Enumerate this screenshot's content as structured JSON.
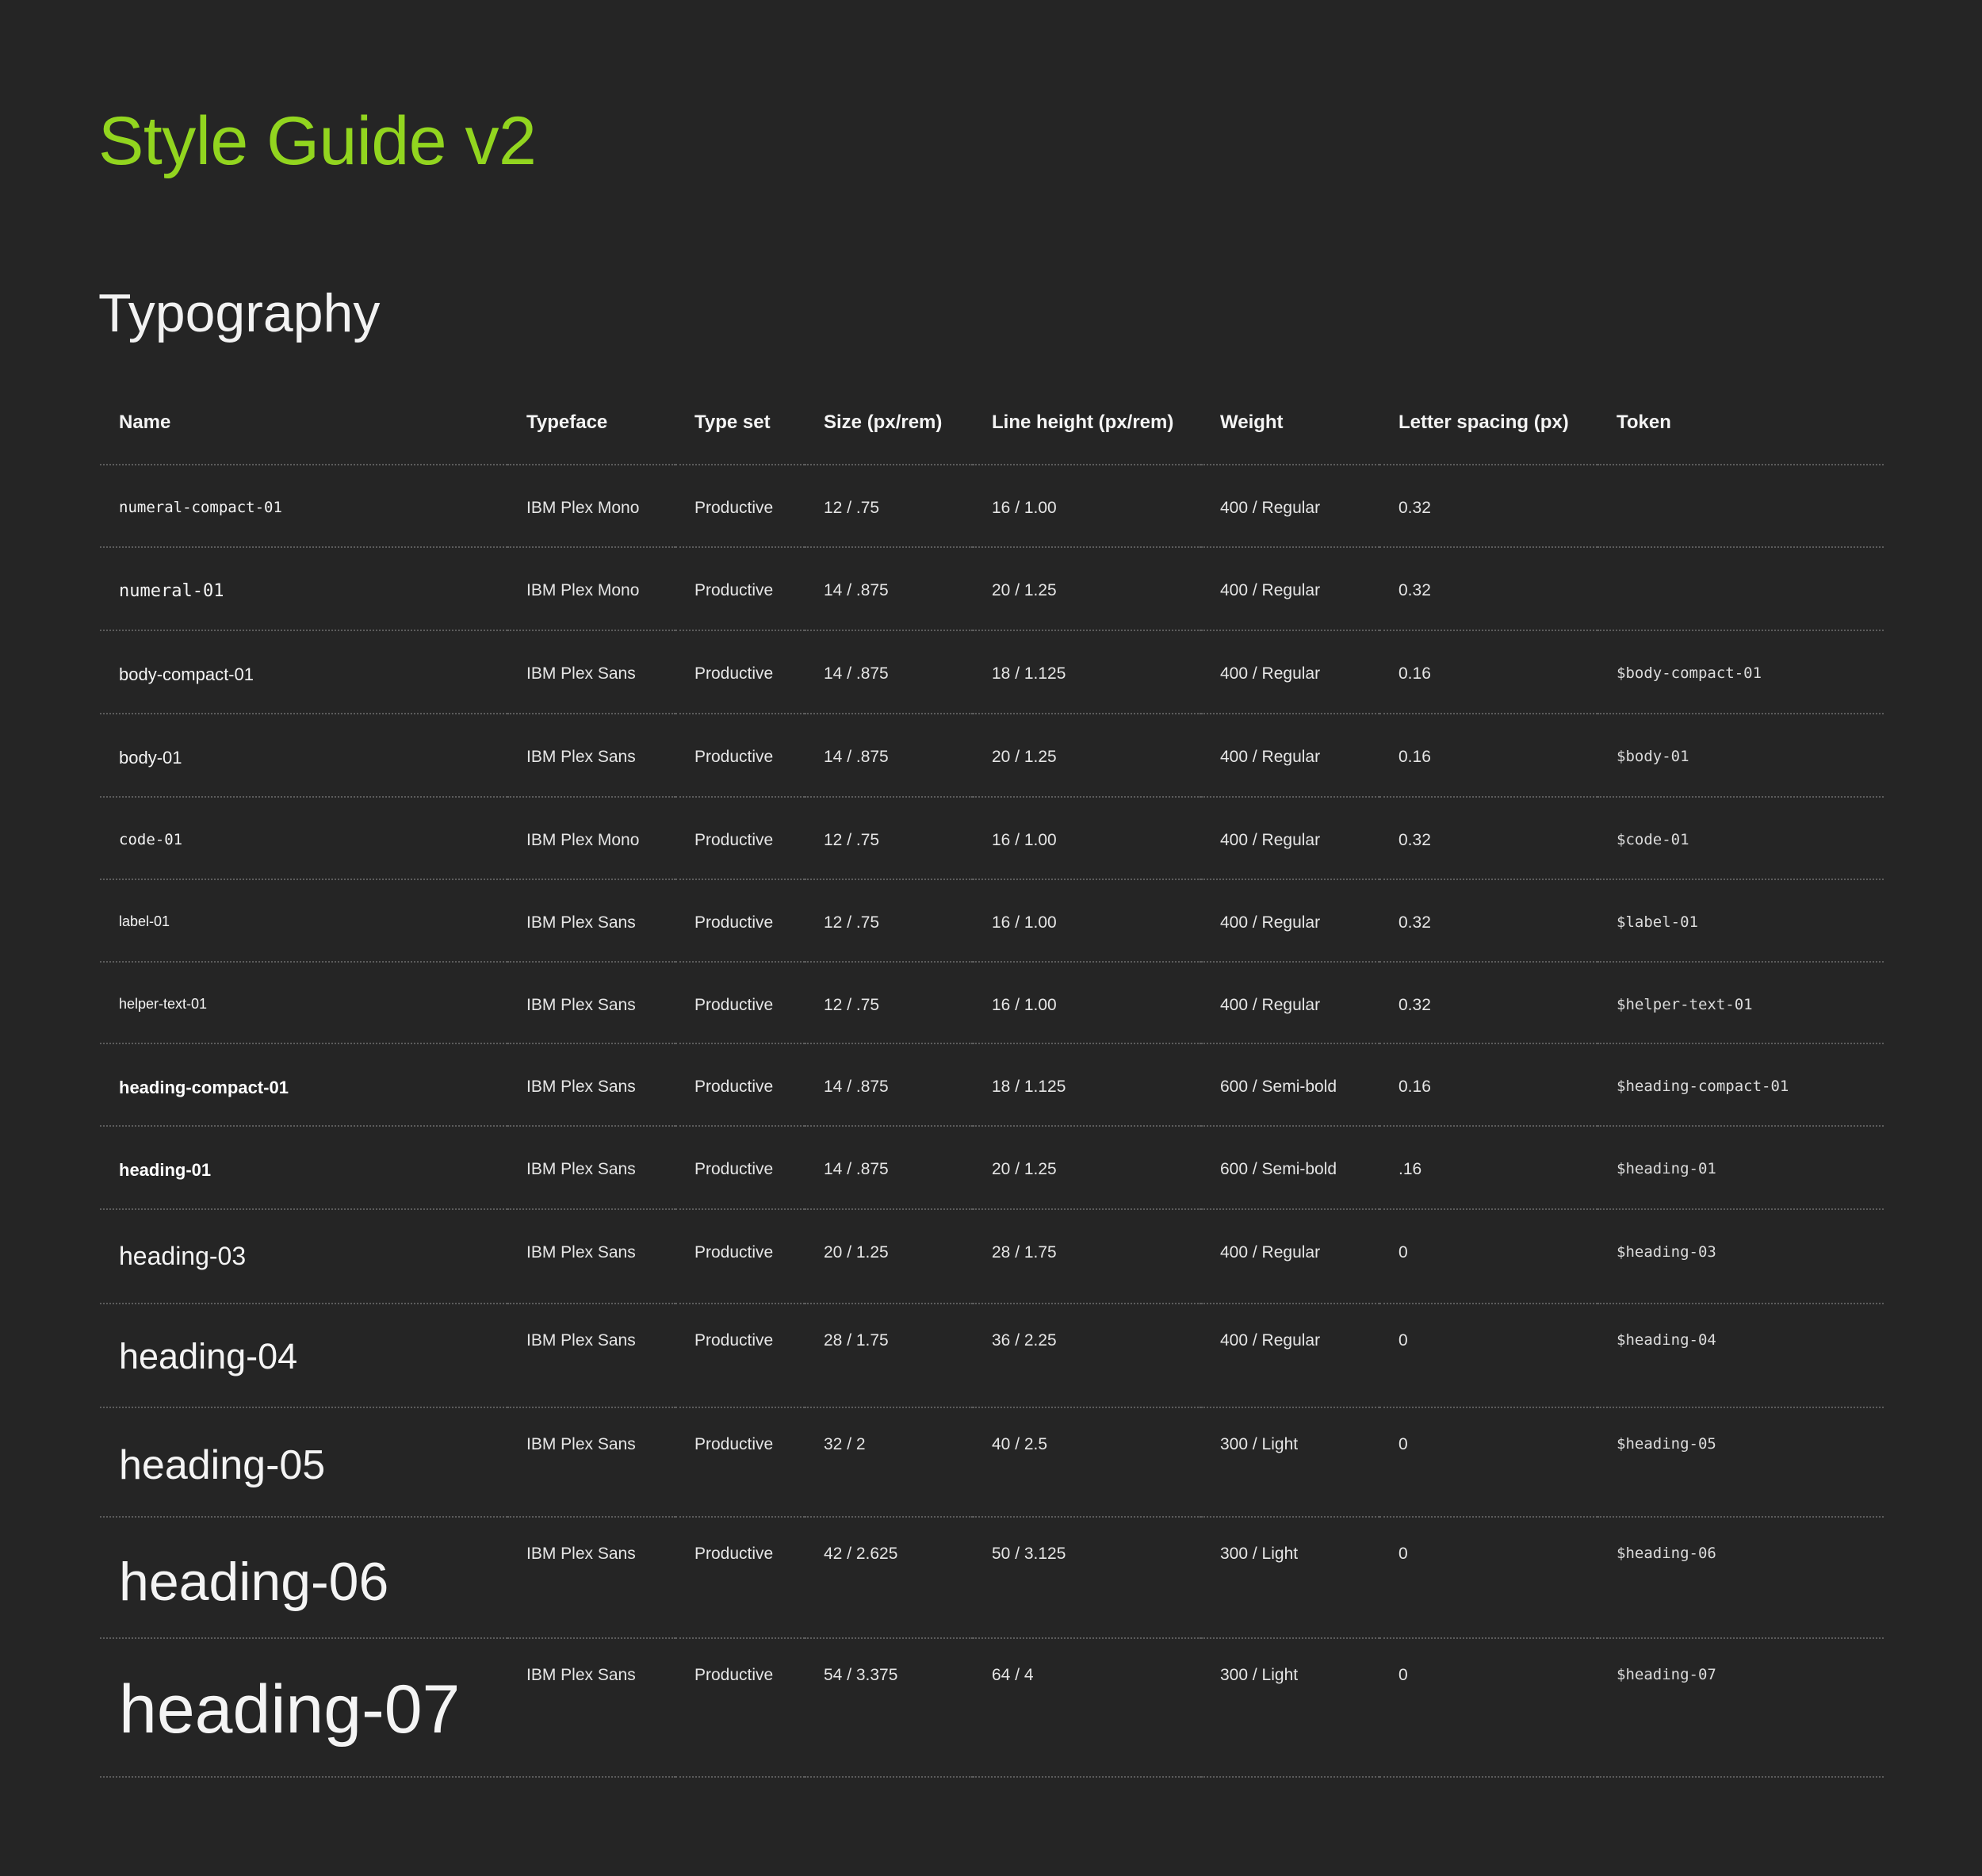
{
  "page": {
    "title": "Style Guide v2",
    "section_title": "Typography",
    "accent_color": "#92d51f",
    "background_color": "#252525"
  },
  "table": {
    "headers": [
      "Name",
      "Typeface",
      "Type set",
      "Size (px/rem)",
      "Line height (px/rem)",
      "Weight",
      "Letter spacing (px)",
      "Token"
    ],
    "rows": [
      {
        "name": "numeral-compact-01",
        "typeface": "IBM Plex Mono",
        "type_set": "Productive",
        "size": "12 / .75",
        "line_height": "16 / 1.00",
        "weight": "400 / Regular",
        "letter_spacing": "0.32",
        "token": ""
      },
      {
        "name": "numeral-01",
        "typeface": "IBM Plex Mono",
        "type_set": "Productive",
        "size": "14 / .875",
        "line_height": "20 / 1.25",
        "weight": "400 / Regular",
        "letter_spacing": "0.32",
        "token": ""
      },
      {
        "name": "body-compact-01",
        "typeface": "IBM Plex Sans",
        "type_set": "Productive",
        "size": "14 / .875",
        "line_height": "18 / 1.125",
        "weight": "400 / Regular",
        "letter_spacing": "0.16",
        "token": "$body-compact-01"
      },
      {
        "name": "body-01",
        "typeface": "IBM Plex Sans",
        "type_set": "Productive",
        "size": "14 / .875",
        "line_height": "20 / 1.25",
        "weight": "400 / Regular",
        "letter_spacing": "0.16",
        "token": "$body-01"
      },
      {
        "name": "code-01",
        "typeface": "IBM Plex Mono",
        "type_set": "Productive",
        "size": "12 / .75",
        "line_height": "16 / 1.00",
        "weight": "400 / Regular",
        "letter_spacing": "0.32",
        "token": "$code-01"
      },
      {
        "name": "label-01",
        "typeface": "IBM Plex Sans",
        "type_set": "Productive",
        "size": "12 / .75",
        "line_height": "16 / 1.00",
        "weight": "400 / Regular",
        "letter_spacing": "0.32",
        "token": "$label-01"
      },
      {
        "name": "helper-text-01",
        "typeface": "IBM Plex Sans",
        "type_set": "Productive",
        "size": "12 / .75",
        "line_height": "16 / 1.00",
        "weight": "400 / Regular",
        "letter_spacing": "0.32",
        "token": "$helper-text-01"
      },
      {
        "name": "heading-compact-01",
        "typeface": "IBM Plex Sans",
        "type_set": "Productive",
        "size": "14 / .875",
        "line_height": "18 / 1.125",
        "weight": "600 / Semi-bold",
        "letter_spacing": "0.16",
        "token": "$heading-compact-01"
      },
      {
        "name": "heading-01",
        "typeface": "IBM Plex Sans",
        "type_set": "Productive",
        "size": "14 / .875",
        "line_height": "20 / 1.25",
        "weight": "600 / Semi-bold",
        "letter_spacing": ".16",
        "token": "$heading-01"
      },
      {
        "name": "heading-03",
        "typeface": "IBM Plex Sans",
        "type_set": "Productive",
        "size": "20 / 1.25",
        "line_height": "28 / 1.75",
        "weight": "400 / Regular",
        "letter_spacing": "0",
        "token": "$heading-03"
      },
      {
        "name": "heading-04",
        "typeface": "IBM Plex Sans",
        "type_set": "Productive",
        "size": "28 / 1.75",
        "line_height": "36 / 2.25",
        "weight": "400 / Regular",
        "letter_spacing": "0",
        "token": "$heading-04"
      },
      {
        "name": "heading-05",
        "typeface": "IBM Plex Sans",
        "type_set": "Productive",
        "size": "32 / 2",
        "line_height": "40 / 2.5",
        "weight": "300 / Light",
        "letter_spacing": "0",
        "token": "$heading-05"
      },
      {
        "name": "heading-06",
        "typeface": "IBM Plex Sans",
        "type_set": "Productive",
        "size": "42 / 2.625",
        "line_height": "50 / 3.125",
        "weight": "300 / Light",
        "letter_spacing": "0",
        "token": "$heading-06"
      },
      {
        "name": "heading-07",
        "typeface": "IBM Plex Sans",
        "type_set": "Productive",
        "size": "54 / 3.375",
        "line_height": "64 / 4",
        "weight": "300 / Light",
        "letter_spacing": "0",
        "token": "$heading-07"
      }
    ]
  }
}
